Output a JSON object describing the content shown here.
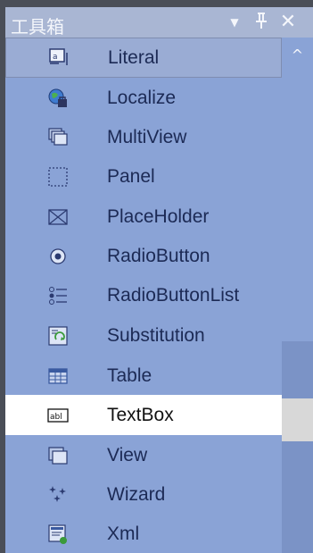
{
  "toolbox": {
    "title": "工具箱",
    "title_buttons": {
      "dropdown": "▼",
      "pin": "ᵽ",
      "close": "✕"
    },
    "items": [
      {
        "label": "Literal",
        "icon": "literal-icon",
        "state": "selected"
      },
      {
        "label": "Localize",
        "icon": "localize-icon",
        "state": "normal"
      },
      {
        "label": "MultiView",
        "icon": "multiview-icon",
        "state": "normal"
      },
      {
        "label": "Panel",
        "icon": "panel-icon",
        "state": "normal"
      },
      {
        "label": "PlaceHolder",
        "icon": "placeholder-icon",
        "state": "normal"
      },
      {
        "label": "RadioButton",
        "icon": "radiobutton-icon",
        "state": "normal"
      },
      {
        "label": "RadioButtonList",
        "icon": "radiobuttonlist-icon",
        "state": "normal"
      },
      {
        "label": "Substitution",
        "icon": "substitution-icon",
        "state": "normal"
      },
      {
        "label": "Table",
        "icon": "table-icon",
        "state": "normal"
      },
      {
        "label": "TextBox",
        "icon": "textbox-icon",
        "state": "hover"
      },
      {
        "label": "View",
        "icon": "view-icon",
        "state": "normal"
      },
      {
        "label": "Wizard",
        "icon": "wizard-icon",
        "state": "normal"
      },
      {
        "label": "Xml",
        "icon": "xml-icon",
        "state": "normal"
      }
    ],
    "scrollbar": {
      "up_arrow": "^"
    }
  },
  "colors": {
    "panel_bg": "#8aa3d6",
    "title_bg": "#a9b6d3",
    "label_text": "#1c2a55",
    "hover_bg": "#ffffff",
    "selected_bg": "#9aacd4"
  }
}
